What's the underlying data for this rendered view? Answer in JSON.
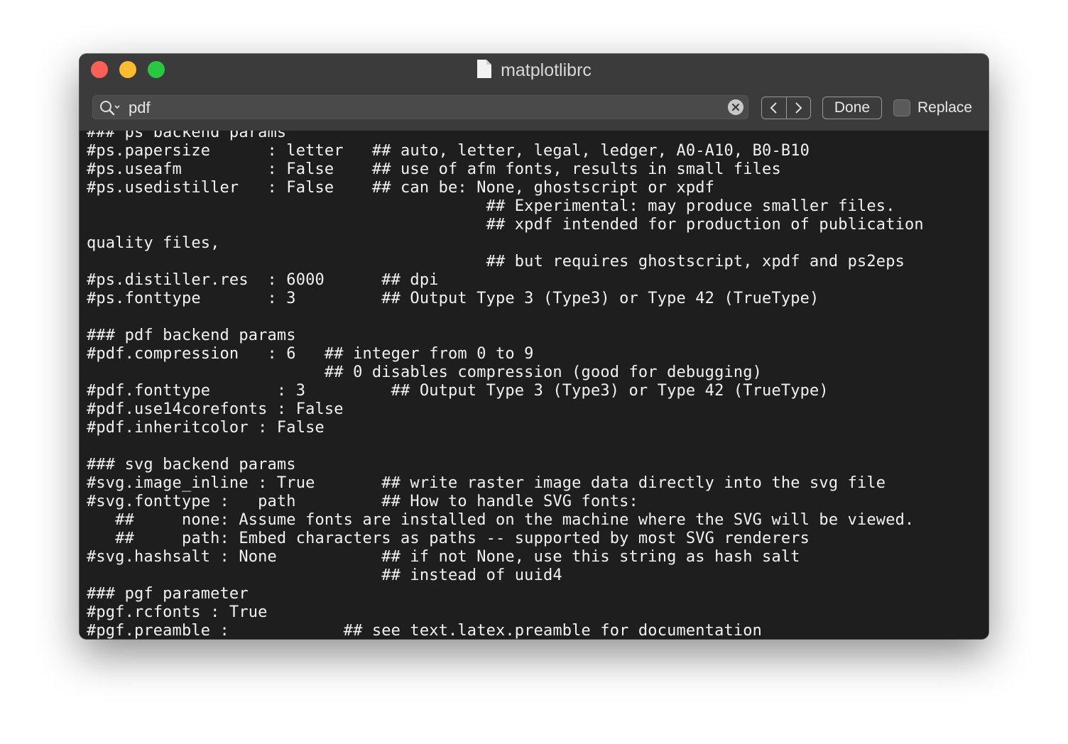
{
  "window": {
    "title": "matplotlibrc"
  },
  "find_bar": {
    "query": "pdf",
    "done_label": "Done",
    "replace_label": "Replace",
    "replace_checked": false
  },
  "editor": {
    "lines": [
      "### ps backend params",
      "#ps.papersize      : letter   ## auto, letter, legal, ledger, A0-A10, B0-B10",
      "#ps.useafm         : False    ## use of afm fonts, results in small files",
      "#ps.usedistiller   : False    ## can be: None, ghostscript or xpdf",
      "                                          ## Experimental: may produce smaller files.",
      "                                          ## xpdf intended for production of publication",
      "quality files,",
      "                                          ## but requires ghostscript, xpdf and ps2eps",
      "#ps.distiller.res  : 6000      ## dpi",
      "#ps.fonttype       : 3         ## Output Type 3 (Type3) or Type 42 (TrueType)",
      "",
      "### pdf backend params",
      "#pdf.compression   : 6   ## integer from 0 to 9",
      "                         ## 0 disables compression (good for debugging)",
      "#pdf.fonttype       : 3         ## Output Type 3 (Type3) or Type 42 (TrueType)",
      "#pdf.use14corefonts : False",
      "#pdf.inheritcolor : False",
      "",
      "### svg backend params",
      "#svg.image_inline : True       ## write raster image data directly into the svg file",
      "#svg.fonttype :   path         ## How to handle SVG fonts:",
      "   ##     none: Assume fonts are installed on the machine where the SVG will be viewed.",
      "   ##     path: Embed characters as paths -- supported by most SVG renderers",
      "#svg.hashsalt : None           ## if not None, use this string as hash salt",
      "                               ## instead of uuid4",
      "### pgf parameter",
      "#pgf.rcfonts : True",
      "#pgf.preamble :            ## see text.latex.preamble for documentation"
    ]
  }
}
